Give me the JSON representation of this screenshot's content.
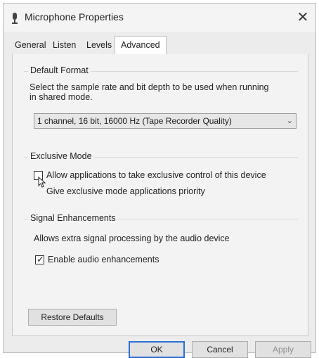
{
  "window": {
    "title": "Microphone Properties",
    "close_glyph": "✕"
  },
  "tabs": [
    {
      "label": "General"
    },
    {
      "label": "Listen"
    },
    {
      "label": "Levels"
    },
    {
      "label": "Advanced",
      "active": true
    }
  ],
  "default_format": {
    "heading": "Default Format",
    "description_line1": "Select the sample rate and bit depth to be used when running",
    "description_line2": "in shared mode.",
    "selected_value": "1 channel, 16 bit, 16000 Hz (Tape Recorder Quality)"
  },
  "exclusive_mode": {
    "heading": "Exclusive Mode",
    "allow_label": "Allow applications to take exclusive control of this device",
    "allow_checked": false,
    "priority_label": "Give exclusive mode applications priority",
    "priority_enabled": false
  },
  "signal_enhancements": {
    "heading": "Signal Enhancements",
    "description": "Allows extra signal processing by the audio device",
    "enable_label": "Enable audio enhancements",
    "enable_checked": true
  },
  "buttons": {
    "restore_defaults": "Restore Defaults",
    "ok": "OK",
    "cancel": "Cancel",
    "apply": "Apply"
  },
  "icons": {
    "title": "microphone-icon",
    "close": "close-icon",
    "dropdown": "chevron-down-icon",
    "checkmark": "checkmark-icon",
    "cursor": "mouse-pointer-icon"
  },
  "colors": {
    "dialog_bg": "#ececec",
    "default_button_border": "#2c6fd6"
  }
}
